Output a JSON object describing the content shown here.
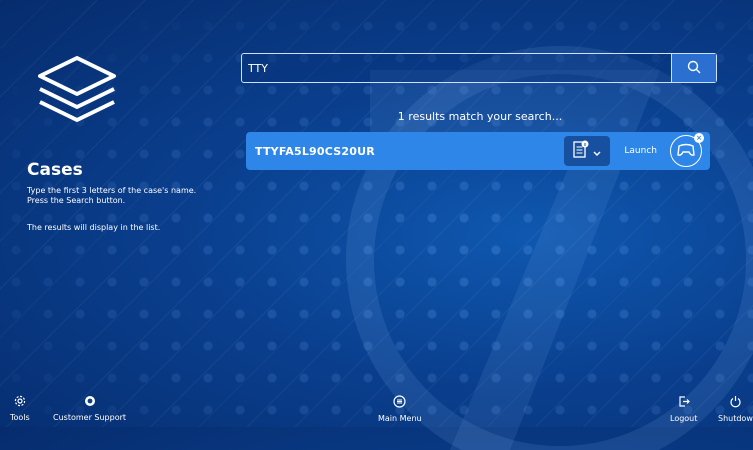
{
  "cases": {
    "title": "Cases",
    "instructions": "Type the first 3 letters of the case's name. Press the Search button.",
    "results_hint": "The results will display in the list."
  },
  "search": {
    "value": "TTY",
    "button_icon": "search-icon"
  },
  "results": {
    "count_text": "1 results match your search...",
    "items": [
      {
        "name": "TTYFA5L90CS20UR",
        "doc_icon": "document-info-icon",
        "dropdown_icon": "chevron-down-icon",
        "launch_label": "Launch",
        "launch_icon": "controller-icon"
      }
    ]
  },
  "bottom_bar": {
    "tools": "Tools",
    "customer_support": "Customer Support",
    "main_menu": "Main Menu",
    "logout": "Logout",
    "shutdown": "Shutdow"
  },
  "colors": {
    "background": "#0a3f8e",
    "result_row": "#2d86e8",
    "doc_button": "#17509f"
  }
}
